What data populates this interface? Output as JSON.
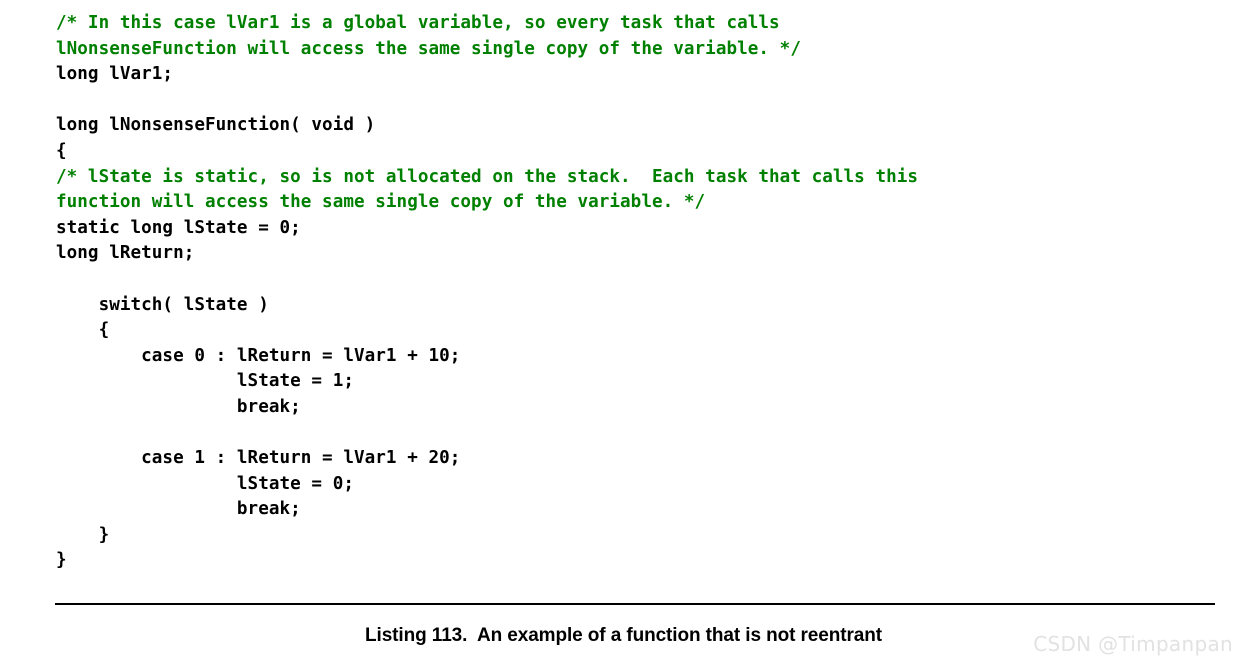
{
  "document": {
    "background_color": "#ffffff",
    "code_color": "#000000",
    "comment_color": "#008000",
    "rule_color": "#000000"
  },
  "code_listing": {
    "language": "c",
    "lines": [
      {
        "kind": "comment",
        "text": "/* In this case lVar1 is a global variable, so every task that calls"
      },
      {
        "kind": "comment",
        "text": "lNonsenseFunction will access the same single copy of the variable. */"
      },
      {
        "kind": "code",
        "text": "long lVar1;"
      },
      {
        "kind": "blank",
        "text": ""
      },
      {
        "kind": "code",
        "text": "long lNonsenseFunction( void )"
      },
      {
        "kind": "code",
        "text": "{"
      },
      {
        "kind": "comment",
        "text": "/* lState is static, so is not allocated on the stack.  Each task that calls this"
      },
      {
        "kind": "comment",
        "text": "function will access the same single copy of the variable. */"
      },
      {
        "kind": "code",
        "text": "static long lState = 0;"
      },
      {
        "kind": "code",
        "text": "long lReturn;"
      },
      {
        "kind": "blank",
        "text": ""
      },
      {
        "kind": "code",
        "text": "    switch( lState )"
      },
      {
        "kind": "code",
        "text": "    {"
      },
      {
        "kind": "code",
        "text": "        case 0 : lReturn = lVar1 + 10;"
      },
      {
        "kind": "code",
        "text": "                 lState = 1;"
      },
      {
        "kind": "code",
        "text": "                 break;"
      },
      {
        "kind": "blank",
        "text": ""
      },
      {
        "kind": "code",
        "text": "        case 1 : lReturn = lVar1 + 20;"
      },
      {
        "kind": "code",
        "text": "                 lState = 0;"
      },
      {
        "kind": "code",
        "text": "                 break;"
      },
      {
        "kind": "code",
        "text": "    }"
      },
      {
        "kind": "code",
        "text": "}"
      }
    ]
  },
  "caption": {
    "text": "Listing 113.  An example of a function that is not reentrant"
  },
  "watermark": {
    "text": "CSDN @Timpanpan"
  }
}
